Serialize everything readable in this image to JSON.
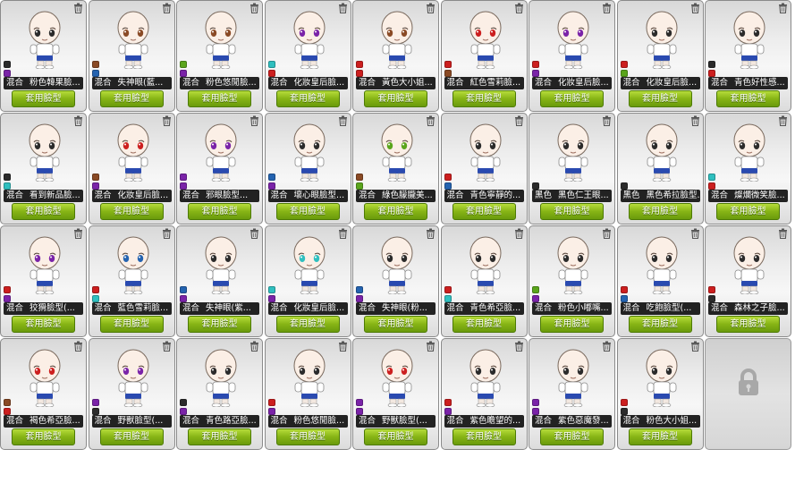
{
  "colors": {
    "black": "#2b2b2b",
    "brown": "#8a4a25",
    "green": "#5aa51c",
    "cyan": "#2fbfbf",
    "red": "#cc1f1f",
    "purple": "#7a23a8",
    "blue": "#2463b0",
    "button_green": "#86b415"
  },
  "icons": {
    "delete": "trash-icon",
    "locked_slot": "lock-icon"
  },
  "slots": [
    {
      "type": "混合",
      "name": "粉色韓果臉...",
      "button": "套用臉型",
      "chips": [
        "black",
        "purple"
      ],
      "eyes": "black"
    },
    {
      "type": "混合",
      "name": "失神眼(藍...",
      "button": "套用臉型",
      "chips": [
        "brown",
        "blue"
      ],
      "eyes": "brown"
    },
    {
      "type": "混合",
      "name": "粉色悠閒臉...",
      "button": "套用臉型",
      "chips": [
        "green",
        "purple"
      ],
      "eyes": "brown"
    },
    {
      "type": "混合",
      "name": "化妝皇后臉...",
      "button": "套用臉型",
      "chips": [
        "cyan",
        "red"
      ],
      "eyes": "purple"
    },
    {
      "type": "混合",
      "name": "黃色大小姐...",
      "button": "套用臉型",
      "chips": [
        "red",
        "red"
      ],
      "eyes": "brown"
    },
    {
      "type": "混合",
      "name": "紅色雪莉臉...",
      "button": "套用臉型",
      "chips": [
        "red",
        "brown"
      ],
      "eyes": "red"
    },
    {
      "type": "混合",
      "name": "化妝皇后臉...",
      "button": "套用臉型",
      "chips": [
        "red",
        "purple"
      ],
      "eyes": "purple"
    },
    {
      "type": "混合",
      "name": "化妝皇后臉...",
      "button": "套用臉型",
      "chips": [
        "red",
        "green"
      ],
      "eyes": "black"
    },
    {
      "type": "混合",
      "name": "青色好性感...",
      "button": "套用臉型",
      "chips": [
        "black",
        "red"
      ],
      "eyes": "black"
    },
    {
      "type": "混合",
      "name": "看到新品臉...",
      "button": "套用臉型",
      "chips": [
        "black",
        "cyan"
      ],
      "eyes": "black"
    },
    {
      "type": "混合",
      "name": "化妝皇后臉...",
      "button": "套用臉型",
      "chips": [
        "brown",
        "purple"
      ],
      "eyes": "red"
    },
    {
      "type": "混合",
      "name": "邪眼臉型...",
      "button": "套用臉型",
      "chips": [
        "purple",
        "purple"
      ],
      "eyes": "purple"
    },
    {
      "type": "混合",
      "name": "壞心眼臉型...",
      "button": "套用臉型",
      "chips": [
        "blue",
        "purple"
      ],
      "eyes": "black"
    },
    {
      "type": "混合",
      "name": "綠色朦朧美...",
      "button": "套用臉型",
      "chips": [
        "brown",
        "green"
      ],
      "eyes": "green"
    },
    {
      "type": "混合",
      "name": "青色寧靜的...",
      "button": "套用臉型",
      "chips": [
        "red",
        "blue"
      ],
      "eyes": "black"
    },
    {
      "type": "黑色",
      "name": "黑色仁王眼...",
      "button": "套用臉型",
      "chips": [
        "black"
      ],
      "eyes": "black"
    },
    {
      "type": "黑色",
      "name": "黑色希拉臉型...",
      "button": "套用臉型",
      "chips": [
        "black"
      ],
      "eyes": "black"
    },
    {
      "type": "混合",
      "name": "燦爛微笑臉...",
      "button": "套用臉型",
      "chips": [
        "cyan",
        "red"
      ],
      "eyes": "black"
    },
    {
      "type": "混合",
      "name": "狡猾臉型(...",
      "button": "套用臉型",
      "chips": [
        "red",
        "purple"
      ],
      "eyes": "purple"
    },
    {
      "type": "混合",
      "name": "藍色雪莉臉...",
      "button": "套用臉型",
      "chips": [
        "red",
        "cyan"
      ],
      "eyes": "blue"
    },
    {
      "type": "混合",
      "name": "失神眼(紫...",
      "button": "套用臉型",
      "chips": [
        "blue",
        "purple"
      ],
      "eyes": "black"
    },
    {
      "type": "混合",
      "name": "化妝皇后臉...",
      "button": "套用臉型",
      "chips": [
        "cyan",
        "purple"
      ],
      "eyes": "cyan"
    },
    {
      "type": "混合",
      "name": "失神眼(粉...",
      "button": "套用臉型",
      "chips": [
        "blue",
        "purple"
      ],
      "eyes": "black"
    },
    {
      "type": "混合",
      "name": "青色希亞臉...",
      "button": "套用臉型",
      "chips": [
        "red",
        "cyan"
      ],
      "eyes": "black"
    },
    {
      "type": "混合",
      "name": "粉色小嘟嘴...",
      "button": "套用臉型",
      "chips": [
        "green",
        "purple"
      ],
      "eyes": "black"
    },
    {
      "type": "混合",
      "name": "吃飽臉型(...",
      "button": "套用臉型",
      "chips": [
        "red",
        "blue"
      ],
      "eyes": "black"
    },
    {
      "type": "混合",
      "name": "森林之子臉...",
      "button": "套用臉型",
      "chips": [
        "red",
        "black"
      ],
      "eyes": "black"
    },
    {
      "type": "混合",
      "name": "褐色希亞臉...",
      "button": "套用臉型",
      "chips": [
        "brown",
        "red"
      ],
      "eyes": "red"
    },
    {
      "type": "混合",
      "name": "野獸臉型(...",
      "button": "套用臉型",
      "chips": [
        "purple",
        "black"
      ],
      "eyes": "purple"
    },
    {
      "type": "混合",
      "name": "青色路亞臉...",
      "button": "套用臉型",
      "chips": [
        "black",
        "purple"
      ],
      "eyes": "black"
    },
    {
      "type": "混合",
      "name": "粉色悠閒臉...",
      "button": "套用臉型",
      "chips": [
        "red",
        "purple"
      ],
      "eyes": "black"
    },
    {
      "type": "混合",
      "name": "野獸臉型(...",
      "button": "套用臉型",
      "chips": [
        "purple",
        "purple"
      ],
      "eyes": "red"
    },
    {
      "type": "混合",
      "name": "紫色瞻望的...",
      "button": "套用臉型",
      "chips": [
        "red",
        "purple"
      ],
      "eyes": "black"
    },
    {
      "type": "混合",
      "name": "紫色惡魔發...",
      "button": "套用臉型",
      "chips": [
        "purple",
        "purple"
      ],
      "eyes": "black"
    },
    {
      "type": "混合",
      "name": "粉色大小姐...",
      "button": "套用臉型",
      "chips": [
        "red",
        "black"
      ],
      "eyes": "black"
    },
    {
      "locked": true
    }
  ]
}
